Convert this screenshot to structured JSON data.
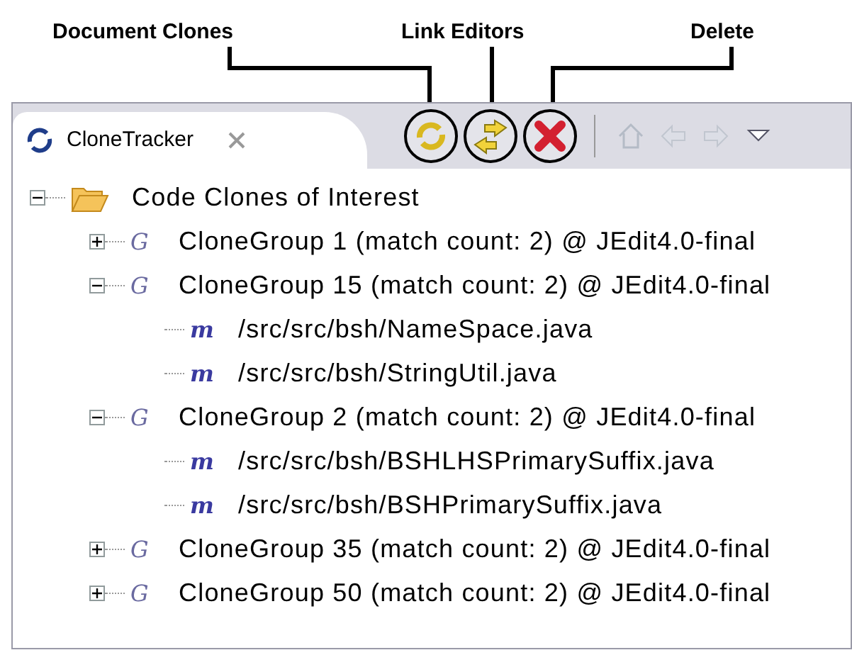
{
  "callouts": [
    {
      "label": "Document Clones"
    },
    {
      "label": "Link Editors"
    },
    {
      "label": "Delete"
    }
  ],
  "view_tab": {
    "title": "CloneTracker",
    "selected": true
  },
  "toolbar": [
    {
      "kind": "document-clones",
      "disabled": false
    },
    {
      "kind": "link-editors",
      "disabled": false
    },
    {
      "kind": "delete",
      "disabled": false
    },
    {
      "kind": "home",
      "disabled": true
    },
    {
      "kind": "back",
      "disabled": true
    },
    {
      "kind": "forward",
      "disabled": true
    },
    {
      "kind": "menu",
      "disabled": false
    }
  ],
  "tree": [
    {
      "kind": "folder",
      "label": "Code Clones of Interest",
      "expanded": true,
      "children": [
        {
          "kind": "group",
          "glyph": "G",
          "label": "CloneGroup 1 (match count: 2) @ JEdit4.0-final",
          "expanded": false
        },
        {
          "kind": "group",
          "glyph": "G",
          "label": "CloneGroup 15 (match count: 2) @ JEdit4.0-final",
          "expanded": true,
          "children": [
            {
              "kind": "file",
              "glyph": "m",
              "label": "/src/src/bsh/NameSpace.java"
            },
            {
              "kind": "file",
              "glyph": "m",
              "label": "/src/src/bsh/StringUtil.java"
            }
          ]
        },
        {
          "kind": "group",
          "glyph": "G",
          "label": "CloneGroup 2 (match count: 2) @ JEdit4.0-final",
          "expanded": true,
          "children": [
            {
              "kind": "file",
              "glyph": "m",
              "label": "/src/src/bsh/BSHLHSPrimarySuffix.java"
            },
            {
              "kind": "file",
              "glyph": "m",
              "label": "/src/src/bsh/BSHPrimarySuffix.java"
            }
          ]
        },
        {
          "kind": "group",
          "glyph": "G",
          "label": "CloneGroup 35 (match count: 2) @ JEdit4.0-final",
          "expanded": false
        },
        {
          "kind": "group",
          "glyph": "G",
          "label": "CloneGroup 50 (match count: 2) @ JEdit4.0-final",
          "expanded": false
        }
      ]
    }
  ]
}
